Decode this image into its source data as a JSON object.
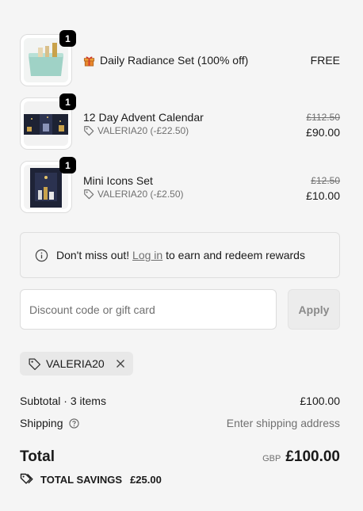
{
  "items": [
    {
      "quantity": "1",
      "title": "Daily Radiance Set (100% off)",
      "price": "FREE",
      "is_gift": true
    },
    {
      "quantity": "1",
      "title": "12 Day Advent Calendar",
      "discount": "VALERIA20 (-£22.50)",
      "original_price": "£112.50",
      "price": "£90.00"
    },
    {
      "quantity": "1",
      "title": "Mini Icons Set",
      "discount": "VALERIA20 (-£2.50)",
      "original_price": "£12.50",
      "price": "£10.00"
    }
  ],
  "banner": {
    "prefix": "Don't miss out!",
    "link": "Log in",
    "suffix": "to earn and redeem rewards"
  },
  "discount_form": {
    "placeholder": "Discount code or gift card",
    "apply_label": "Apply"
  },
  "applied_code": "VALERIA20",
  "summary": {
    "subtotal_label": "Subtotal · 3 items",
    "subtotal_value": "£100.00",
    "shipping_label": "Shipping",
    "shipping_value": "Enter shipping address",
    "total_label": "Total",
    "currency": "GBP",
    "total_value": "£100.00",
    "savings_label": "TOTAL SAVINGS",
    "savings_value": "£25.00"
  },
  "colors": {
    "background": "#f5f5f5",
    "text": "#1a1a1a",
    "muted": "#707070",
    "badge": "#000000"
  }
}
